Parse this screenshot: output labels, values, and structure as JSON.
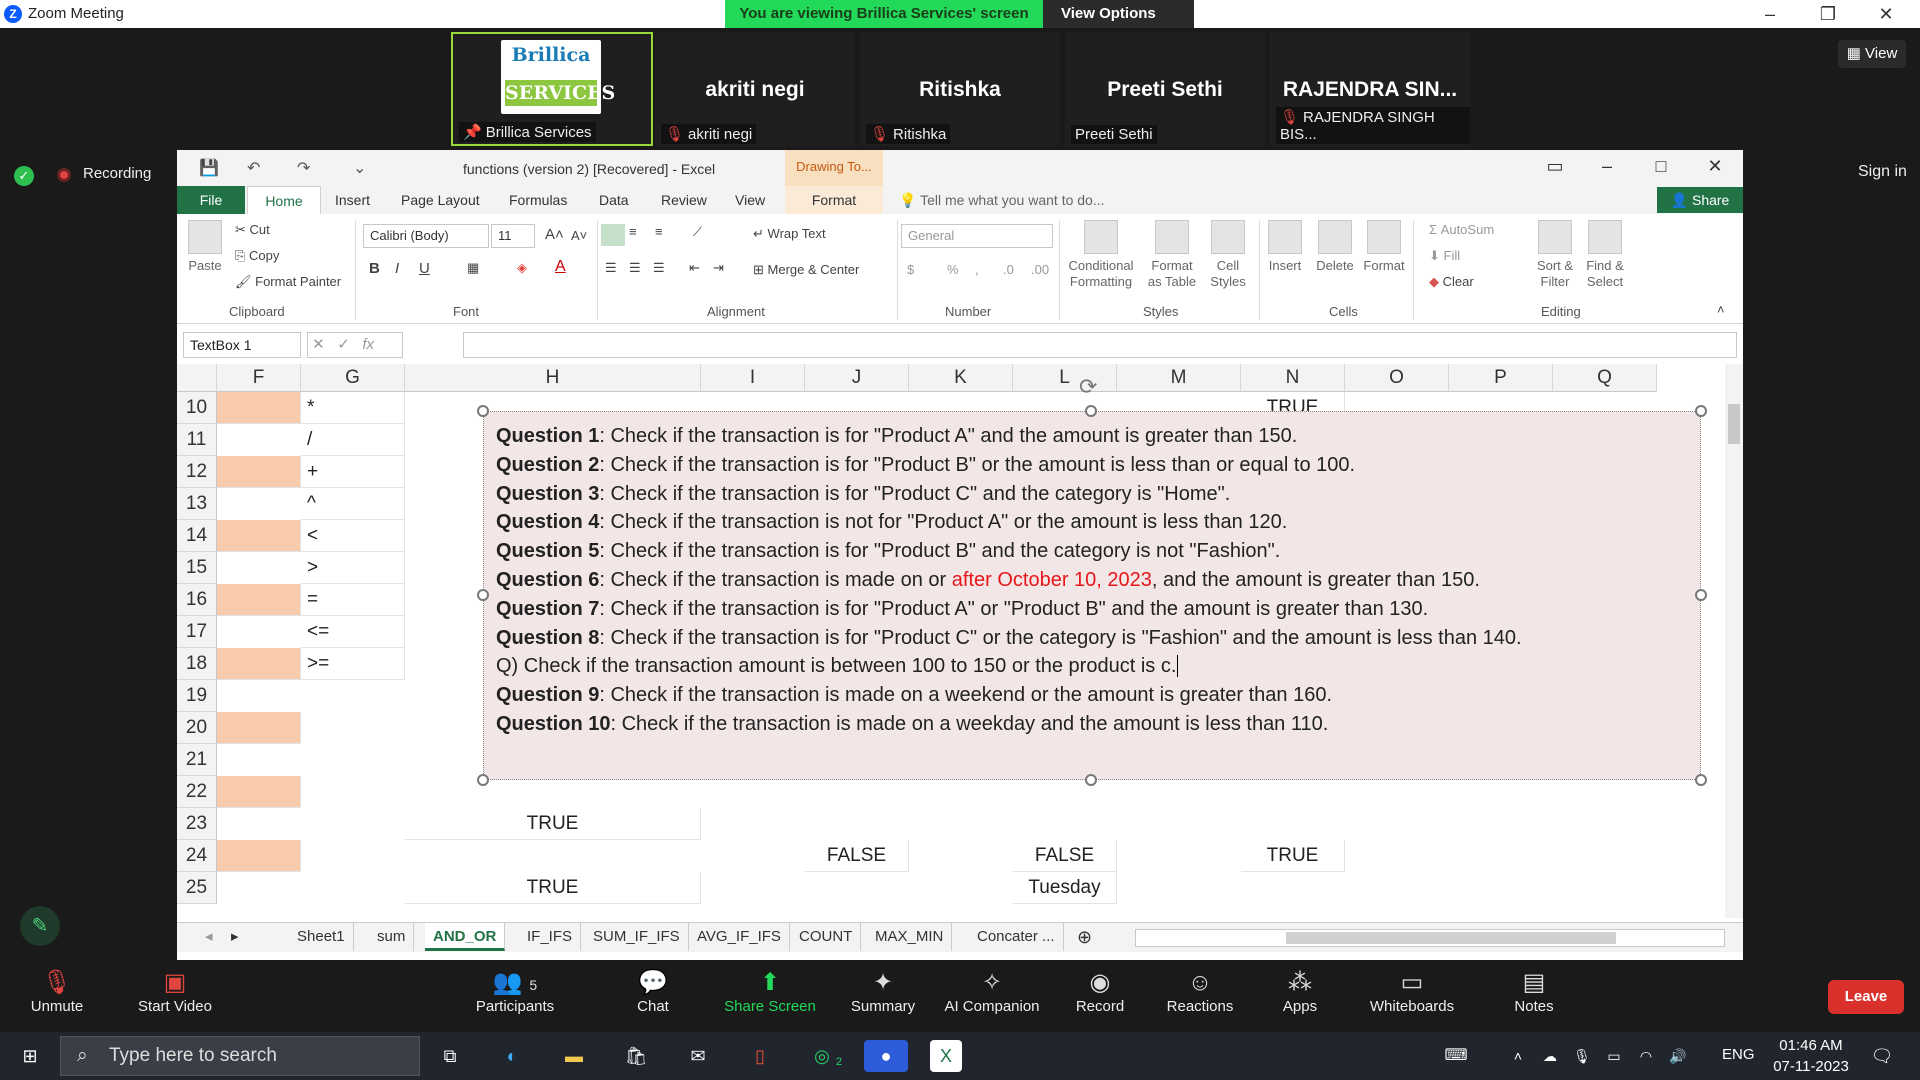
{
  "zoom": {
    "window_title": "Zoom Meeting",
    "viewing_banner": "You are viewing Brillica Services' screen",
    "view_options": "View Options",
    "view_button": "View",
    "recording": "Recording",
    "sign_in": "Sign in"
  },
  "participants": [
    {
      "name": "Brillica Services",
      "logo_top": "Brillica",
      "logo_bottom": "SERVICES",
      "display": ""
    },
    {
      "name": "akriti negi",
      "display": "akriti negi"
    },
    {
      "name": "Ritishka",
      "display": "Ritishka"
    },
    {
      "name": "Preeti Sethi",
      "display": "Preeti Sethi"
    },
    {
      "name": "RAJENDRA SINGH BIS...",
      "display": "RAJENDRA  SIN..."
    }
  ],
  "excel": {
    "title": "functions (version 2) [Recovered] - Excel",
    "drawing_tools": "Drawing To...",
    "tabs": [
      "File",
      "Home",
      "Insert",
      "Page Layout",
      "Formulas",
      "Data",
      "Review",
      "View",
      "Format"
    ],
    "tell_me": "Tell me what you want to do...",
    "share": "Share",
    "clipboard": {
      "paste": "Paste",
      "cut": "Cut",
      "copy": "Copy",
      "format_painter": "Format Painter",
      "group": "Clipboard"
    },
    "font": {
      "name": "Calibri (Body)",
      "size": "11",
      "group": "Font"
    },
    "alignment": {
      "wrap": "Wrap Text",
      "merge": "Merge & Center",
      "group": "Alignment"
    },
    "number": {
      "format": "General",
      "group": "Number"
    },
    "styles": {
      "cond": "Conditional Formatting",
      "table": "Format as Table",
      "cell": "Cell Styles",
      "group": "Styles"
    },
    "cells": {
      "insert": "Insert",
      "delete": "Delete",
      "format": "Format",
      "group": "Cells"
    },
    "editing": {
      "autosum": "AutoSum",
      "fill": "Fill",
      "clear": "Clear",
      "sort": "Sort & Filter",
      "find": "Find & Select",
      "group": "Editing"
    },
    "name_box": "TextBox 1",
    "columns": [
      "F",
      "G",
      "H",
      "I",
      "J",
      "K",
      "L",
      "M",
      "N",
      "O",
      "P",
      "Q"
    ],
    "rows": [
      "10",
      "11",
      "12",
      "13",
      "14",
      "15",
      "16",
      "17",
      "18",
      "19",
      "20",
      "21",
      "22",
      "23",
      "24",
      "25"
    ],
    "col_g": [
      "*",
      "/",
      "+",
      "^",
      "<",
      ">",
      "=",
      "<=",
      ">="
    ],
    "cells_vals": {
      "n10": "TRUE",
      "h23": "TRUE",
      "j24": "FALSE",
      "l24": "FALSE",
      "n24": "TRUE",
      "h25": "TRUE",
      "l25": "Tuesday"
    },
    "textbox": [
      {
        "q": "Question 1",
        "t": ": Check if the transaction is for \"Product A\" and the amount is greater than 150."
      },
      {
        "q": "Question 2",
        "t": ": Check if the transaction is for \"Product B\" or the amount is less than or equal to 100."
      },
      {
        "q": "Question 3",
        "t": ": Check if the transaction is for \"Product C\" and the category is \"Home\"."
      },
      {
        "q": "Question 4",
        "t": ": Check if the transaction is not for \"Product A\" or the amount is less than 120."
      },
      {
        "q": "Question 5",
        "t": ": Check if the transaction is for \"Product B\" and the category is not \"Fashion\"."
      },
      {
        "q": "Question 6",
        "t": ": Check if the transaction is made on or ",
        "red": "after October 10, 2023",
        "t2": ", and the amount is greater than 150."
      },
      {
        "q": "Question 7",
        "t": ": Check if the transaction is for \"Product A\" or \"Product B\" and the amount is greater than 130."
      },
      {
        "q": "Question 8",
        "t": ": Check if the transaction is for \"Product C\" or the category is \"Fashion\" and the amount is less than 140."
      },
      {
        "q": "",
        "t": "Q) Check if the transaction amount is between 100 to 150 or the product is c."
      },
      {
        "q": "Question 9",
        "t": ": Check if the transaction is made on a weekend or the amount is greater than 160."
      },
      {
        "q": "Question 10",
        "t": ": Check if the transaction is made on a weekday and the amount is less than 110."
      }
    ],
    "sheets": [
      "Sheet1",
      "sum",
      "AND_OR",
      "IF_IFS",
      "SUM_IF_IFS",
      "AVG_IF_IFS",
      "COUNT",
      "MAX_MIN",
      "Concater ..."
    ]
  },
  "toolbar": {
    "unmute": "Unmute",
    "video": "Start Video",
    "participants": "Participants",
    "participants_count": "5",
    "chat": "Chat",
    "share": "Share Screen",
    "summary": "Summary",
    "ai": "AI Companion",
    "record": "Record",
    "reactions": "Reactions",
    "apps": "Apps",
    "whiteboards": "Whiteboards",
    "notes": "Notes",
    "leave": "Leave"
  },
  "taskbar": {
    "search": "Type here to search",
    "lang": "ENG",
    "time": "01:46 AM",
    "date": "07-11-2023",
    "whatsapp_badge": "2"
  }
}
